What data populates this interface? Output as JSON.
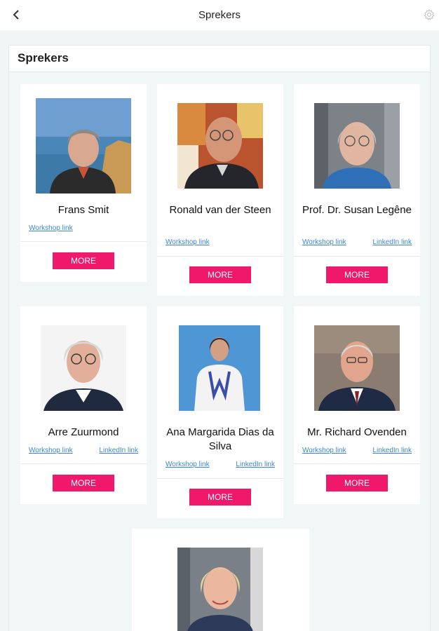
{
  "topbar": {
    "title": "Sprekers",
    "back_icon": "chevron-left-icon",
    "settings_icon": "gear-icon"
  },
  "panel": {
    "title": "Sprekers"
  },
  "speakers": [
    {
      "name": "Frans Smit",
      "workshop": "Workshop link",
      "more": "MORE"
    },
    {
      "name": "Ronald van der Steen",
      "workshop": "Workshop link",
      "more": "MORE"
    },
    {
      "name": "Prof. Dr. Susan Legêne",
      "workshop": "Workshop link",
      "linkedin": "LinkedIn link",
      "more": "MORE"
    },
    {
      "name": "Arre Zuurmond",
      "workshop": "Workshop link",
      "linkedin": "LinkedIn link",
      "more": "MORE"
    },
    {
      "name": "Ana Margarida Dias da Silva",
      "workshop": "Workshop link",
      "linkedin": "LinkedIn link",
      "more": "MORE"
    },
    {
      "name": "Mr. Richard Ovenden",
      "workshop": "Workshop link",
      "linkedin": "LinkedIn link",
      "more": "MORE"
    }
  ],
  "colors": {
    "accent": "#f0186b",
    "link": "#3a86d4",
    "background": "#f1f7f7"
  }
}
